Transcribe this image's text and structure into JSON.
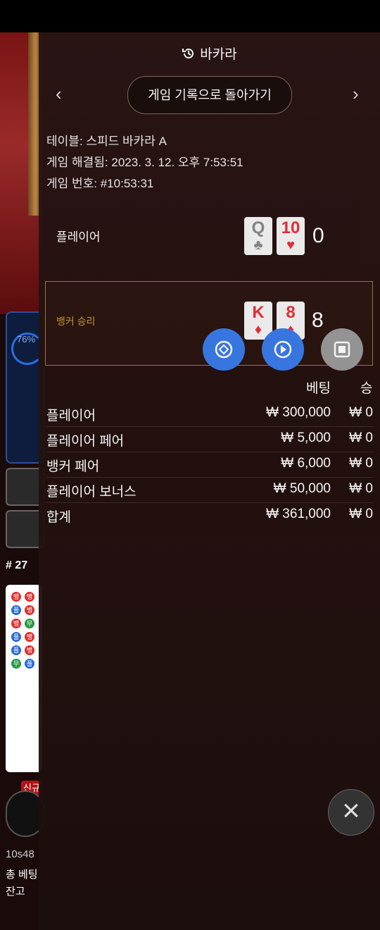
{
  "background": {
    "progress_percent": "76%",
    "round_label": "# 27",
    "new_tag": "신규",
    "user_line": "10s48",
    "total_bet_label": "총 베팅",
    "balance_label": "잔고",
    "road_dots": [
      "뱅",
      "뱅",
      "플",
      "뱅",
      "뱅",
      "무",
      "플",
      "뱅",
      "플",
      "뱅",
      "무",
      "플"
    ]
  },
  "panel": {
    "title": "바카라",
    "back_button": "게임 기록으로 돌아가기",
    "prev_arrow": "‹",
    "next_arrow": "›",
    "info": {
      "table": "테이블: 스피드 바카라 A",
      "resolved": "게임 해결됨: 2023. 3. 12. 오후 7:53:51",
      "game_no": "게임 번호: #10:53:31"
    },
    "player": {
      "label": "플레이어",
      "cards": [
        {
          "rank": "Q",
          "suit": "♣",
          "color": "gray"
        },
        {
          "rank": "10",
          "suit": "♥",
          "color": "red"
        }
      ],
      "score": "0"
    },
    "banker": {
      "label": "뱅커 승리",
      "cards": [
        {
          "rank": "K",
          "suit": "♦",
          "color": "red"
        },
        {
          "rank": "8",
          "suit": "♦",
          "color": "red"
        }
      ],
      "score": "8"
    },
    "table_headers": {
      "bet": "베팅",
      "win": "승"
    },
    "rows": [
      {
        "name": "플레이어",
        "bet": "₩ 300,000",
        "win": "₩ 0"
      },
      {
        "name": "플레이어 페어",
        "bet": "₩ 5,000",
        "win": "₩ 0"
      },
      {
        "name": "뱅커 페어",
        "bet": "₩ 6,000",
        "win": "₩ 0"
      },
      {
        "name": "플레이어 보너스",
        "bet": "₩ 50,000",
        "win": "₩ 0"
      },
      {
        "name": "합계",
        "bet": "₩ 361,000",
        "win": "₩ 0"
      }
    ],
    "close_icon": "×"
  },
  "colors": {
    "accent_blue": "#3a7be8",
    "gold": "#c79a3b",
    "red": "#e8303a"
  }
}
